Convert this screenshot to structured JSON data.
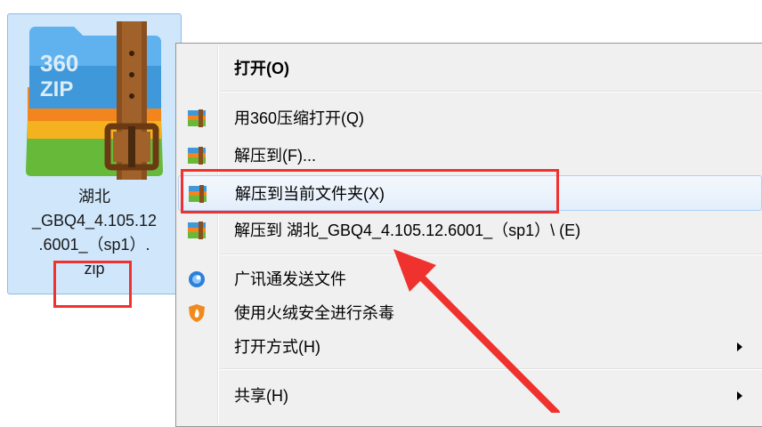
{
  "file": {
    "name_lines": "湖北\n_GBQ4_4.105.12\n.6001_（sp1）.\nzip",
    "icon_text": "360\nZIP"
  },
  "menu": {
    "items": [
      {
        "label": "打开(O)",
        "icon": "none",
        "bold": true
      },
      {
        "label": "用360压缩打开(Q)",
        "icon": "360zip-archive-icon"
      },
      {
        "label": "解压到(F)...",
        "icon": "360zip-archive-icon"
      },
      {
        "label": "解压到当前文件夹(X)",
        "icon": "360zip-archive-icon"
      },
      {
        "label": "解压到 湖北_GBQ4_4.105.12.6001_（sp1）\\ (E)",
        "icon": "360zip-archive-icon"
      },
      {
        "label": "广讯通发送文件",
        "icon": "guangxuntong-icon"
      },
      {
        "label": "使用火绒安全进行杀毒",
        "icon": "huorong-shield-icon"
      },
      {
        "label": "打开方式(H)",
        "icon": "none",
        "submenu": true
      },
      {
        "label": "共享(H)",
        "icon": "none",
        "submenu": true
      }
    ]
  },
  "colors": {
    "annotation": "#f0322f",
    "tile_bg": "#cfe6fb",
    "menu_bg": "#f0f0f0"
  }
}
